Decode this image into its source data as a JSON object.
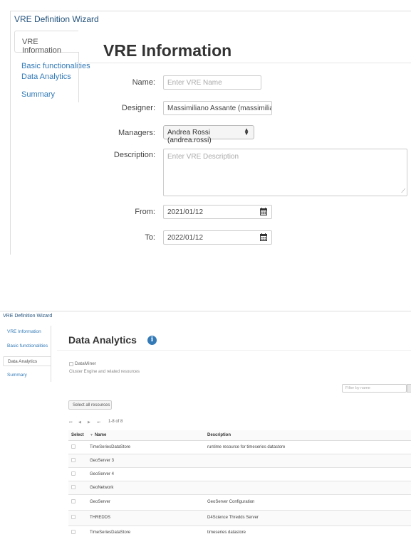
{
  "panel1": {
    "wizard_title": "VRE Definition Wizard",
    "nav": [
      "VRE Information",
      "Basic functionalities",
      "Data Analytics",
      "Summary"
    ],
    "heading": "VRE Information",
    "form": {
      "name_label": "Name:",
      "name_placeholder": "Enter VRE Name",
      "designer_label": "Designer:",
      "designer_value": "Massimiliano Assante (massimiliano.",
      "managers_label": "Managers:",
      "managers_value": "Andrea Rossi (andrea.rossi)",
      "description_label": "Description:",
      "description_placeholder": "Enter VRE Description",
      "from_label": "From:",
      "from_value": "2021/01/12",
      "to_label": "To:",
      "to_value": "2022/01/12"
    }
  },
  "panel2": {
    "wizard_title": "VRE Definition Wizard",
    "nav": [
      "VRE Information",
      "Basic functionalities",
      "Data Analytics",
      "Summary"
    ],
    "heading": "Data Analytics",
    "info_icon": "i",
    "dataminer_label": "DataMiner",
    "dataminer_desc": "Cluster Engine and related resources",
    "filter_placeholder": "Filter by name",
    "select_all_label": "Select all resources",
    "pager_text": "1-8 of 8",
    "table": {
      "columns": [
        "Select",
        "Name",
        "Description"
      ],
      "rows": [
        {
          "name": "TimeSeriesDataStore",
          "description": "runtime resource for timeseries datastore"
        },
        {
          "name": "GeoServer 3",
          "description": ""
        },
        {
          "name": "GeoServer 4",
          "description": ""
        },
        {
          "name": "GeoNetwork",
          "description": ""
        },
        {
          "name": "GeoServer",
          "description": "GeoServer Configuration"
        },
        {
          "name": "THREDDS",
          "description": "D4Science Thredds Server"
        },
        {
          "name": "TimeSeriesDataStore",
          "description": "timeseries datastore"
        }
      ]
    }
  },
  "colors": {
    "link": "#337ab7",
    "title": "#23527c",
    "info_badge": "#337ab7"
  },
  "icons": [
    "calendar-icon",
    "info-icon",
    "select-arrows-icon",
    "resize-grip-icon",
    "sort-arrow-icon",
    "pager-first-icon",
    "pager-prev-icon",
    "pager-next-icon",
    "pager-last-icon"
  ]
}
